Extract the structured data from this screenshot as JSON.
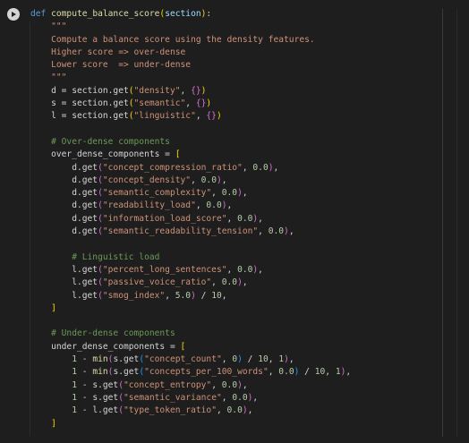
{
  "run_button": {
    "icon": "play-icon"
  },
  "code_lines": [
    [
      [
        "kw",
        "def "
      ],
      [
        "fn",
        "compute_balance_score"
      ],
      [
        "br1",
        "("
      ],
      [
        "var",
        "section"
      ],
      [
        "br1",
        ")"
      ],
      [
        "txt",
        ":"
      ]
    ],
    [
      [
        "str",
        "    \"\"\""
      ]
    ],
    [
      [
        "str",
        "    Compute a balance score using the density features."
      ]
    ],
    [
      [
        "str",
        "    Higher score => over-dense"
      ]
    ],
    [
      [
        "str",
        "    Lower score  => under-dense"
      ]
    ],
    [
      [
        "str",
        "    \"\"\""
      ]
    ],
    [
      [
        "txt",
        "    d = section.get"
      ],
      [
        "br1",
        "("
      ],
      [
        "str",
        "\"density\""
      ],
      [
        "txt",
        ", "
      ],
      [
        "br2",
        "{}"
      ],
      [
        "br1",
        ")"
      ]
    ],
    [
      [
        "txt",
        "    s = section.get"
      ],
      [
        "br1",
        "("
      ],
      [
        "str",
        "\"semantic\""
      ],
      [
        "txt",
        ", "
      ],
      [
        "br2",
        "{}"
      ],
      [
        "br1",
        ")"
      ]
    ],
    [
      [
        "txt",
        "    l = section.get"
      ],
      [
        "br1",
        "("
      ],
      [
        "str",
        "\"linguistic\""
      ],
      [
        "txt",
        ", "
      ],
      [
        "br2",
        "{}"
      ],
      [
        "br1",
        ")"
      ]
    ],
    [
      [
        "txt",
        ""
      ]
    ],
    [
      [
        "com",
        "    # Over-dense components"
      ]
    ],
    [
      [
        "txt",
        "    over_dense_components = "
      ],
      [
        "br1",
        "["
      ]
    ],
    [
      [
        "txt",
        "        d.get"
      ],
      [
        "br2",
        "("
      ],
      [
        "str",
        "\"concept_compression_ratio\""
      ],
      [
        "txt",
        ", "
      ],
      [
        "num",
        "0.0"
      ],
      [
        "br2",
        ")"
      ],
      [
        "txt",
        ","
      ]
    ],
    [
      [
        "txt",
        "        d.get"
      ],
      [
        "br2",
        "("
      ],
      [
        "str",
        "\"concept_density\""
      ],
      [
        "txt",
        ", "
      ],
      [
        "num",
        "0.0"
      ],
      [
        "br2",
        ")"
      ],
      [
        "txt",
        ","
      ]
    ],
    [
      [
        "txt",
        "        d.get"
      ],
      [
        "br2",
        "("
      ],
      [
        "str",
        "\"semantic_complexity\""
      ],
      [
        "txt",
        ", "
      ],
      [
        "num",
        "0.0"
      ],
      [
        "br2",
        ")"
      ],
      [
        "txt",
        ","
      ]
    ],
    [
      [
        "txt",
        "        d.get"
      ],
      [
        "br2",
        "("
      ],
      [
        "str",
        "\"readability_load\""
      ],
      [
        "txt",
        ", "
      ],
      [
        "num",
        "0.0"
      ],
      [
        "br2",
        ")"
      ],
      [
        "txt",
        ","
      ]
    ],
    [
      [
        "txt",
        "        d.get"
      ],
      [
        "br2",
        "("
      ],
      [
        "str",
        "\"information_load_score\""
      ],
      [
        "txt",
        ", "
      ],
      [
        "num",
        "0.0"
      ],
      [
        "br2",
        ")"
      ],
      [
        "txt",
        ","
      ]
    ],
    [
      [
        "txt",
        "        d.get"
      ],
      [
        "br2",
        "("
      ],
      [
        "str",
        "\"semantic_readability_tension\""
      ],
      [
        "txt",
        ", "
      ],
      [
        "num",
        "0.0"
      ],
      [
        "br2",
        ")"
      ],
      [
        "txt",
        ","
      ]
    ],
    [
      [
        "txt",
        ""
      ]
    ],
    [
      [
        "com",
        "        # Linguistic load"
      ]
    ],
    [
      [
        "txt",
        "        l.get"
      ],
      [
        "br2",
        "("
      ],
      [
        "str",
        "\"percent_long_sentences\""
      ],
      [
        "txt",
        ", "
      ],
      [
        "num",
        "0.0"
      ],
      [
        "br2",
        ")"
      ],
      [
        "txt",
        ","
      ]
    ],
    [
      [
        "txt",
        "        l.get"
      ],
      [
        "br2",
        "("
      ],
      [
        "str",
        "\"passive_voice_ratio\""
      ],
      [
        "txt",
        ", "
      ],
      [
        "num",
        "0.0"
      ],
      [
        "br2",
        ")"
      ],
      [
        "txt",
        ","
      ]
    ],
    [
      [
        "txt",
        "        l.get"
      ],
      [
        "br2",
        "("
      ],
      [
        "str",
        "\"smog_index\""
      ],
      [
        "txt",
        ", "
      ],
      [
        "num",
        "5.0"
      ],
      [
        "br2",
        ")"
      ],
      [
        "txt",
        " / "
      ],
      [
        "num",
        "10"
      ],
      [
        "txt",
        ","
      ]
    ],
    [
      [
        "br1",
        "    ]"
      ]
    ],
    [
      [
        "txt",
        ""
      ]
    ],
    [
      [
        "com",
        "    # Under-dense components"
      ]
    ],
    [
      [
        "txt",
        "    under_dense_components = "
      ],
      [
        "br1",
        "["
      ]
    ],
    [
      [
        "txt",
        "        "
      ],
      [
        "num",
        "1"
      ],
      [
        "txt",
        " - "
      ],
      [
        "fn",
        "min"
      ],
      [
        "br2",
        "("
      ],
      [
        "txt",
        "s.get"
      ],
      [
        "br3",
        "("
      ],
      [
        "str",
        "\"concept_count\""
      ],
      [
        "txt",
        ", "
      ],
      [
        "num",
        "0"
      ],
      [
        "br3",
        ")"
      ],
      [
        "txt",
        " / "
      ],
      [
        "num",
        "10"
      ],
      [
        "txt",
        ", "
      ],
      [
        "num",
        "1"
      ],
      [
        "br2",
        ")"
      ],
      [
        "txt",
        ","
      ]
    ],
    [
      [
        "txt",
        "        "
      ],
      [
        "num",
        "1"
      ],
      [
        "txt",
        " - "
      ],
      [
        "fn",
        "min"
      ],
      [
        "br2",
        "("
      ],
      [
        "txt",
        "s.get"
      ],
      [
        "br3",
        "("
      ],
      [
        "str",
        "\"concepts_per_100_words\""
      ],
      [
        "txt",
        ", "
      ],
      [
        "num",
        "0.0"
      ],
      [
        "br3",
        ")"
      ],
      [
        "txt",
        " / "
      ],
      [
        "num",
        "10"
      ],
      [
        "txt",
        ", "
      ],
      [
        "num",
        "1"
      ],
      [
        "br2",
        ")"
      ],
      [
        "txt",
        ","
      ]
    ],
    [
      [
        "txt",
        "        "
      ],
      [
        "num",
        "1"
      ],
      [
        "txt",
        " - s.get"
      ],
      [
        "br2",
        "("
      ],
      [
        "str",
        "\"concept_entropy\""
      ],
      [
        "txt",
        ", "
      ],
      [
        "num",
        "0.0"
      ],
      [
        "br2",
        ")"
      ],
      [
        "txt",
        ","
      ]
    ],
    [
      [
        "txt",
        "        "
      ],
      [
        "num",
        "1"
      ],
      [
        "txt",
        " - s.get"
      ],
      [
        "br2",
        "("
      ],
      [
        "str",
        "\"semantic_variance\""
      ],
      [
        "txt",
        ", "
      ],
      [
        "num",
        "0.0"
      ],
      [
        "br2",
        ")"
      ],
      [
        "txt",
        ","
      ]
    ],
    [
      [
        "txt",
        "        "
      ],
      [
        "num",
        "1"
      ],
      [
        "txt",
        " - l.get"
      ],
      [
        "br2",
        "("
      ],
      [
        "str",
        "\"type_token_ratio\""
      ],
      [
        "txt",
        ", "
      ],
      [
        "num",
        "0.0"
      ],
      [
        "br2",
        ")"
      ],
      [
        "txt",
        ","
      ]
    ],
    [
      [
        "br1",
        "    ]"
      ]
    ]
  ]
}
